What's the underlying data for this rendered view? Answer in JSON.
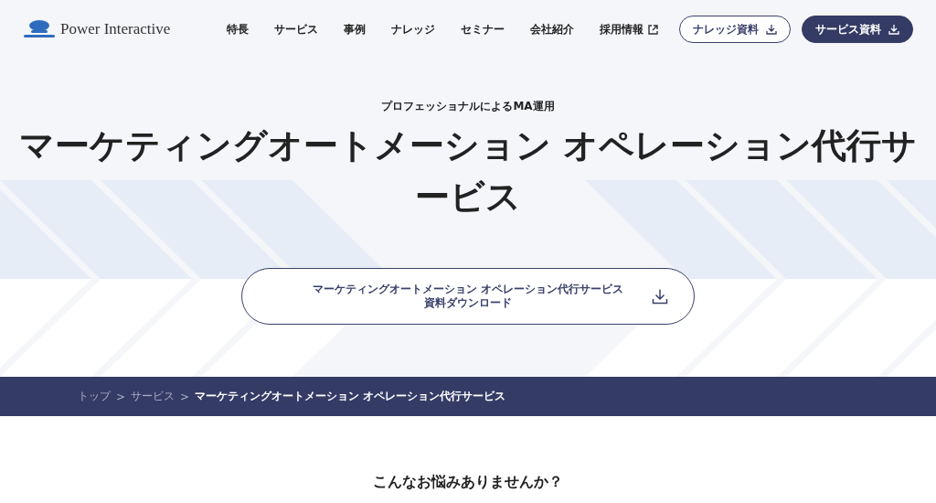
{
  "header": {
    "logo": "Power Interactive",
    "nav": [
      {
        "label": "特長",
        "external": false
      },
      {
        "label": "サービス",
        "external": false
      },
      {
        "label": "事例",
        "external": false
      },
      {
        "label": "ナレッジ",
        "external": false
      },
      {
        "label": "セミナー",
        "external": false
      },
      {
        "label": "会社紹介",
        "external": false
      },
      {
        "label": "採用情報",
        "external": true
      }
    ],
    "buttons": [
      {
        "label": "ナレッジ資料",
        "kind": "outline"
      },
      {
        "label": "サービス資料",
        "kind": "filled"
      }
    ]
  },
  "hero": {
    "eyebrow": "プロフェッショナルによるMA運用",
    "title": "マーケティングオートメーション オペレーション代行サービス",
    "download": {
      "line_1": "マーケティングオートメーション オペレーション代行サービス",
      "line_2": "資料ダウンロード"
    }
  },
  "breadcrumb": {
    "separator": ">",
    "items": [
      {
        "label": "トップ",
        "current": false
      },
      {
        "label": "サービス",
        "current": false
      },
      {
        "label": "マーケティングオートメーション オペレーション代行サービス",
        "current": true
      }
    ]
  },
  "section": {
    "heading": "こんなお悩みありませんか？"
  }
}
